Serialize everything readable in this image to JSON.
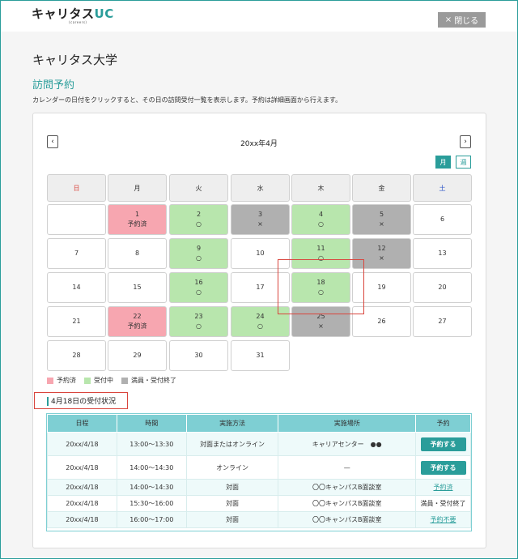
{
  "header": {
    "logo_main": "キャリタス",
    "logo_uc": "UC",
    "logo_sub": "(careers)",
    "close_label": "閉じる",
    "close_icon": "×"
  },
  "page": {
    "university": "キャリタス大学",
    "section_title": "訪問予約",
    "description": "カレンダーの日付をクリックすると、その日の訪問受付一覧を表示します。予約は詳細画面から行えます。"
  },
  "calendar": {
    "prev_icon": "‹",
    "next_icon": "›",
    "month_title": "20xx年4月",
    "view_month": "月",
    "view_week": "週",
    "weekdays": [
      "日",
      "月",
      "火",
      "水",
      "木",
      "金",
      "土"
    ],
    "weekday_colors": [
      "#d9453d",
      "#333333",
      "#333333",
      "#333333",
      "#333333",
      "#333333",
      "#2e55c8"
    ],
    "days": [
      {
        "d": "",
        "s": "",
        "t": "empty"
      },
      {
        "d": "1",
        "s": "予約済",
        "t": "reserved"
      },
      {
        "d": "2",
        "s": "○",
        "t": "open"
      },
      {
        "d": "3",
        "s": "×",
        "t": "full"
      },
      {
        "d": "4",
        "s": "○",
        "t": "open"
      },
      {
        "d": "5",
        "s": "×",
        "t": "full"
      },
      {
        "d": "6",
        "s": "",
        "t": "none"
      },
      {
        "d": "7",
        "s": "",
        "t": "none"
      },
      {
        "d": "8",
        "s": "",
        "t": "none"
      },
      {
        "d": "9",
        "s": "○",
        "t": "open"
      },
      {
        "d": "10",
        "s": "",
        "t": "none"
      },
      {
        "d": "11",
        "s": "○",
        "t": "open"
      },
      {
        "d": "12",
        "s": "×",
        "t": "full"
      },
      {
        "d": "13",
        "s": "",
        "t": "none"
      },
      {
        "d": "14",
        "s": "",
        "t": "none"
      },
      {
        "d": "15",
        "s": "",
        "t": "none"
      },
      {
        "d": "16",
        "s": "○",
        "t": "open"
      },
      {
        "d": "17",
        "s": "",
        "t": "none"
      },
      {
        "d": "18",
        "s": "○",
        "t": "open"
      },
      {
        "d": "19",
        "s": "",
        "t": "none"
      },
      {
        "d": "20",
        "s": "",
        "t": "none"
      },
      {
        "d": "21",
        "s": "",
        "t": "none"
      },
      {
        "d": "22",
        "s": "予約済",
        "t": "reserved"
      },
      {
        "d": "23",
        "s": "○",
        "t": "open"
      },
      {
        "d": "24",
        "s": "○",
        "t": "open"
      },
      {
        "d": "25",
        "s": "×",
        "t": "full"
      },
      {
        "d": "26",
        "s": "",
        "t": "none"
      },
      {
        "d": "27",
        "s": "",
        "t": "none"
      },
      {
        "d": "28",
        "s": "",
        "t": "none"
      },
      {
        "d": "29",
        "s": "",
        "t": "none"
      },
      {
        "d": "30",
        "s": "",
        "t": "none"
      },
      {
        "d": "31",
        "s": "",
        "t": "none"
      }
    ]
  },
  "legend": [
    {
      "label": "予約済",
      "color": "#f7a6b0"
    },
    {
      "label": "受付中",
      "color": "#b8e6ad"
    },
    {
      "label": "満員・受付終了",
      "color": "#b0b0b0"
    }
  ],
  "status": {
    "title": "4月18日の受付状況",
    "columns": [
      "日程",
      "時間",
      "実施方法",
      "実施場所",
      "予約"
    ],
    "rows": [
      {
        "date": "20xx/4/18",
        "time": "13:00〜13:30",
        "method": "対面またはオンライン",
        "place": "キャリアセンター　●●",
        "action": "予約する",
        "kind": "button"
      },
      {
        "date": "20xx/4/18",
        "time": "14:00〜14:30",
        "method": "オンライン",
        "place": "—",
        "action": "予約する",
        "kind": "button"
      },
      {
        "date": "20xx/4/18",
        "time": "14:00〜14:30",
        "method": "対面",
        "place": "〇〇キャンパスB面談室",
        "action": "予約済",
        "kind": "link"
      },
      {
        "date": "20xx/4/18",
        "time": "15:30〜16:00",
        "method": "対面",
        "place": "〇〇キャンパスB面談室",
        "action": "満員・受付終了",
        "kind": "text"
      },
      {
        "date": "20xx/4/18",
        "time": "16:00〜17:00",
        "method": "対面",
        "place": "〇〇キャンパスB面談室",
        "action": "予約不要",
        "kind": "link"
      }
    ]
  }
}
